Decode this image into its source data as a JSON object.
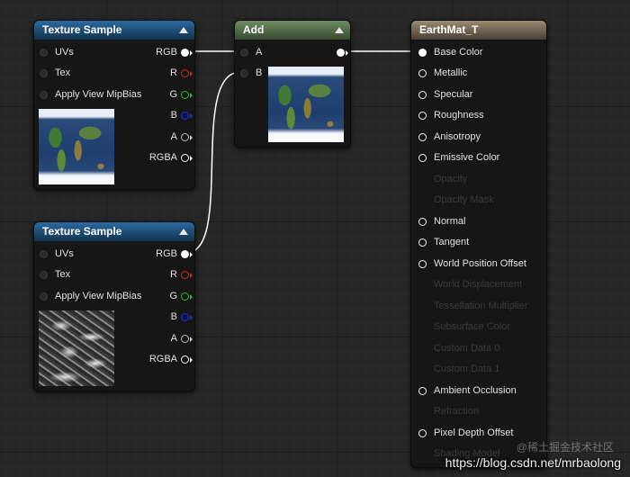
{
  "nodes": {
    "texture_sample_1": {
      "title": "Texture Sample",
      "inputs": [
        "UVs",
        "Tex",
        "Apply View MipBias"
      ],
      "outputs": [
        "RGB",
        "R",
        "G",
        "B",
        "A",
        "RGBA"
      ]
    },
    "texture_sample_2": {
      "title": "Texture Sample",
      "inputs": [
        "UVs",
        "Tex",
        "Apply View MipBias"
      ],
      "outputs": [
        "RGB",
        "R",
        "G",
        "B",
        "A",
        "RGBA"
      ]
    },
    "add": {
      "title": "Add",
      "inputs": [
        "A",
        "B"
      ]
    },
    "material": {
      "title": "EarthMat_T",
      "pins": [
        {
          "label": "Base Color",
          "enabled": true
        },
        {
          "label": "Metallic",
          "enabled": true
        },
        {
          "label": "Specular",
          "enabled": true
        },
        {
          "label": "Roughness",
          "enabled": true
        },
        {
          "label": "Anisotropy",
          "enabled": true
        },
        {
          "label": "Emissive Color",
          "enabled": true
        },
        {
          "label": "Opacity",
          "enabled": false
        },
        {
          "label": "Opacity Mask",
          "enabled": false
        },
        {
          "label": "Normal",
          "enabled": true
        },
        {
          "label": "Tangent",
          "enabled": true
        },
        {
          "label": "World Position Offset",
          "enabled": true
        },
        {
          "label": "World Displacement",
          "enabled": false
        },
        {
          "label": "Tessellation Multiplier",
          "enabled": false
        },
        {
          "label": "Subsurface Color",
          "enabled": false
        },
        {
          "label": "Custom Data 0",
          "enabled": false
        },
        {
          "label": "Custom Data 1",
          "enabled": false
        },
        {
          "label": "Ambient Occlusion",
          "enabled": true
        },
        {
          "label": "Refraction",
          "enabled": false
        },
        {
          "label": "Pixel Depth Offset",
          "enabled": true
        },
        {
          "label": "Shading Model",
          "enabled": false
        }
      ]
    }
  },
  "icons": {
    "collapse": "triangle-up-icon",
    "pin": "pin-icon",
    "thumbnail_earth": "earth-texture-preview",
    "thumbnail_noise": "noise-texture-preview"
  },
  "colors": {
    "texture_header": "#2c6ba0",
    "add_header": "#6e8c62",
    "material_header": "#9a8a74",
    "pin_r": "#d12020",
    "pin_g": "#20c020",
    "pin_b": "#2a2acf",
    "wire": "#ffffff"
  },
  "watermark": {
    "url": "https://blog.csdn.net/mrbaolong",
    "faint": "@稀土掘金技术社区"
  }
}
